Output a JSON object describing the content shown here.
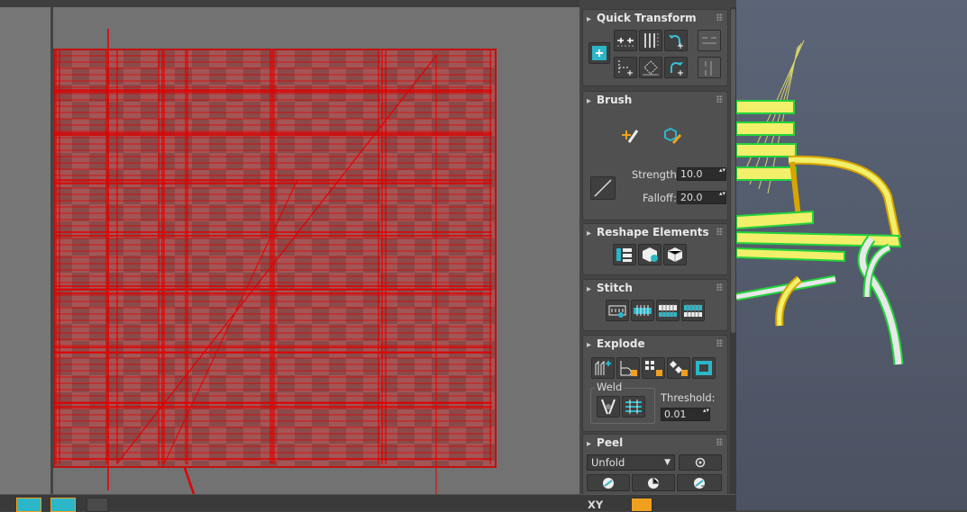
{
  "rollouts": {
    "quick_transform": {
      "title": "Quick Transform"
    },
    "brush": {
      "title": "Brush",
      "strength_label": "Strength:",
      "strength_value": "10.0",
      "falloff_label": "Falloff:",
      "falloff_value": "20.0"
    },
    "reshape": {
      "title": "Reshape Elements"
    },
    "stitch": {
      "title": "Stitch"
    },
    "explode": {
      "title": "Explode",
      "weld_group": "Weld",
      "threshold_label": "Threshold:",
      "threshold_value": "0.01"
    },
    "peel": {
      "title": "Peel",
      "mode_value": "Unfold"
    }
  },
  "bottom_toolbar": {
    "axis_label": "XY"
  },
  "colors": {
    "uv_edge": "#e00000",
    "accent_teal": "#2bb7c8",
    "accent_orange": "#f0a020",
    "selection_green": "#22d33a",
    "bench_yellow": "#f2ef6a"
  }
}
